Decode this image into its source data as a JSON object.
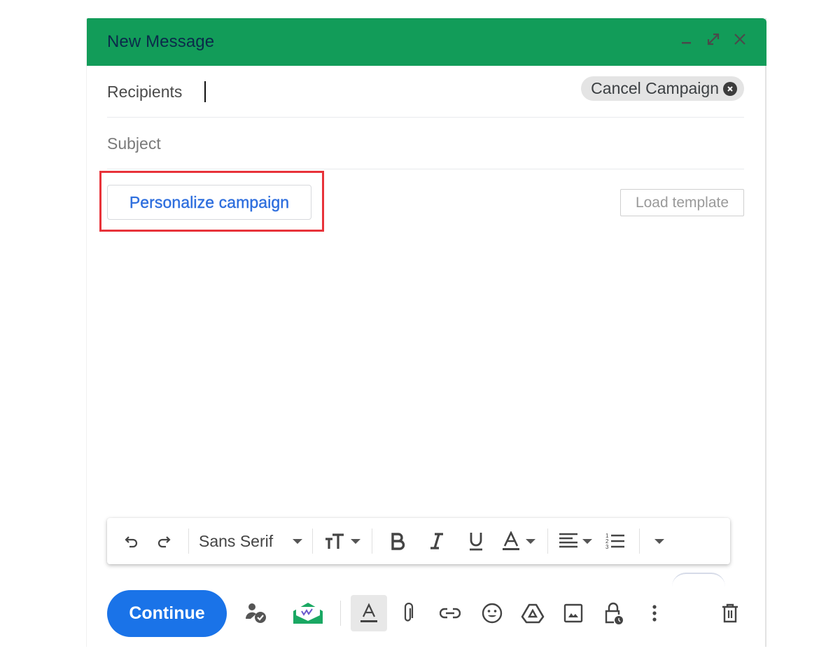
{
  "compose": {
    "title": "New Message",
    "header_icons": [
      "minimize-icon",
      "expand-icon",
      "close-icon"
    ],
    "header_color": "#129c59",
    "recipients": {
      "label": "Recipients",
      "value": ""
    },
    "subject": {
      "placeholder": "Subject",
      "value": ""
    },
    "cancel_campaign_label": "Cancel Campaign",
    "personalize_label": "Personalize campaign",
    "load_template_label": "Load template",
    "highlight_color": "#e8333a"
  },
  "format_bar": {
    "font_name": "Sans Serif",
    "items": [
      "undo-icon",
      "redo-icon",
      "font-select",
      "text-size-icon",
      "bold-icon",
      "italic-icon",
      "underline-icon",
      "text-color-icon",
      "align-icon",
      "numbered-list-icon",
      "more-formatting-icon"
    ]
  },
  "bottom_bar": {
    "continue_label": "Continue",
    "continue_color": "#1a73e8",
    "icons": [
      "recipient-check-icon",
      "mail-tracking-icon",
      "formatting-options-icon",
      "attach-icon",
      "link-icon",
      "emoji-icon",
      "drive-icon",
      "photo-icon",
      "confidential-mode-icon",
      "more-options-icon",
      "discard-icon"
    ]
  }
}
